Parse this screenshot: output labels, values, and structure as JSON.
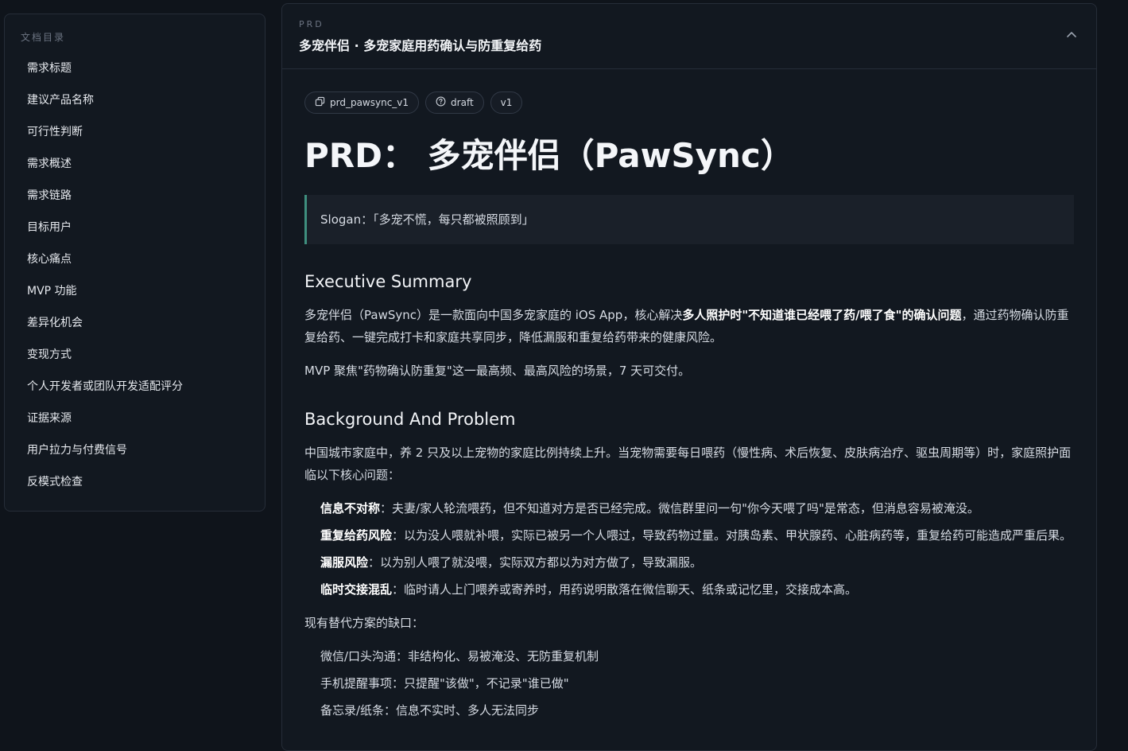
{
  "sidebar": {
    "title": "文档目录",
    "items": [
      {
        "label": "需求标题"
      },
      {
        "label": "建议产品名称"
      },
      {
        "label": "可行性判断"
      },
      {
        "label": "需求概述"
      },
      {
        "label": "需求链路"
      },
      {
        "label": "目标用户"
      },
      {
        "label": "核心痛点"
      },
      {
        "label": "MVP 功能"
      },
      {
        "label": "差异化机会"
      },
      {
        "label": "变现方式"
      },
      {
        "label": "个人开发者或团队开发适配评分"
      },
      {
        "label": "证据来源"
      },
      {
        "label": "用户拉力与付费信号"
      },
      {
        "label": "反模式检查"
      }
    ]
  },
  "panel": {
    "eyebrow": "PRD",
    "title": "多宠伴侣 · 多宠家庭用药确认与防重复给药",
    "collapse_icon": "chevron-up-icon"
  },
  "doc": {
    "chips": [
      {
        "icon": "copy-icon",
        "label": "prd_pawsync_v1"
      },
      {
        "icon": "help-circle-icon",
        "label": "draft"
      },
      {
        "icon": "",
        "label": "v1"
      }
    ],
    "title": "PRD： 多宠伴侣（PawSync）",
    "slogan": "Slogan：「多宠不慌，每只都被照顾到」",
    "exec_heading": "Executive Summary",
    "exec_p1_a": "多宠伴侣（PawSync）是一款面向中国多宠家庭的 iOS App，核心解决",
    "exec_p1_bold": "多人照护时\"不知道谁已经喂了药/喂了食\"的确认问题",
    "exec_p1_b": "，通过药物确认防重复给药、一键完成打卡和家庭共享同步，降低漏服和重复给药带来的健康风险。",
    "exec_p2": "MVP 聚焦\"药物确认防重复\"这一最高频、最高风险的场景，7 天可交付。",
    "bg_heading": "Background And Problem",
    "bg_p1": "中国城市家庭中，养 2 只及以上宠物的家庭比例持续上升。当宠物需要每日喂药（慢性病、术后恢复、皮肤病治疗、驱虫周期等）时，家庭照护面临以下核心问题：",
    "problems": [
      {
        "bold": "信息不对称",
        "text": "：夫妻/家人轮流喂药，但不知道对方是否已经完成。微信群里问一句\"你今天喂了吗\"是常态，但消息容易被淹没。"
      },
      {
        "bold": "重复给药风险",
        "text": "：以为没人喂就补喂，实际已被另一个人喂过，导致药物过量。对胰岛素、甲状腺药、心脏病药等，重复给药可能造成严重后果。"
      },
      {
        "bold": "漏服风险",
        "text": "：以为别人喂了就没喂，实际双方都以为对方做了，导致漏服。"
      },
      {
        "bold": "临时交接混乱",
        "text": "：临时请人上门喂养或寄养时，用药说明散落在微信聊天、纸条或记忆里，交接成本高。"
      }
    ],
    "alt_heading": "现有替代方案的缺口：",
    "alternatives": [
      {
        "text": "微信/口头沟通：非结构化、易被淹没、无防重复机制"
      },
      {
        "text": "手机提醒事项：只提醒\"该做\"，不记录\"谁已做\""
      },
      {
        "text": "备忘录/纸条：信息不实时、多人无法同步"
      }
    ]
  }
}
